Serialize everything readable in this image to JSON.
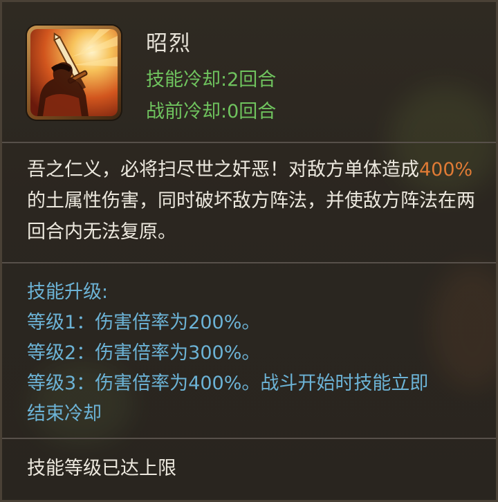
{
  "skill": {
    "name": "昭烈",
    "icon": "sword-warrior-icon",
    "cooldown": "技能冷却:2回合",
    "pre_battle_cooldown": "战前冷却:0回合"
  },
  "description": {
    "part1": "吾之仁义，必将扫尽世之奸恶！对敌方单体造成",
    "highlight": "400%",
    "part2": "的土属性伤害，同时破坏敌方阵法，并使敌方阵法在两回合内无法复原。"
  },
  "upgrade": {
    "title": "技能升级:",
    "levels": [
      "等级1：伤害倍率为200%。",
      "等级2：伤害倍率为300%。",
      "等级3：伤害倍率为400%。战斗开始时技能立即",
      "结束冷却"
    ]
  },
  "footer": {
    "status": "技能等级已达上限"
  },
  "colors": {
    "cooldown_green": "#6fc35e",
    "highlight_orange": "#e07b35",
    "upgrade_blue": "#6cb3d6",
    "text": "#ece8de"
  }
}
